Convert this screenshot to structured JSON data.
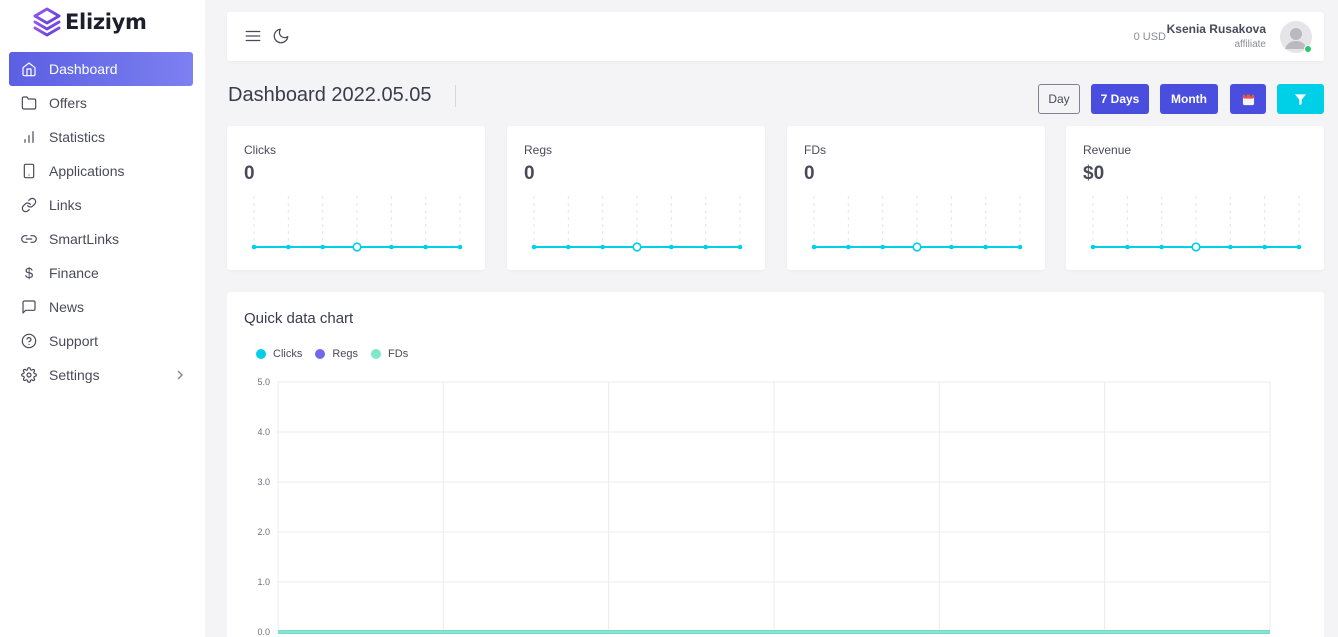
{
  "brand": {
    "name": "Eliziym"
  },
  "sidebar": {
    "items": [
      {
        "label": "Dashboard",
        "icon": "home-icon",
        "active": true
      },
      {
        "label": "Offers",
        "icon": "folder-icon"
      },
      {
        "label": "Statistics",
        "icon": "bar-chart-icon"
      },
      {
        "label": "Applications",
        "icon": "smartphone-icon"
      },
      {
        "label": "Links",
        "icon": "link-icon"
      },
      {
        "label": "SmartLinks",
        "icon": "link-2-icon"
      },
      {
        "label": "Finance",
        "icon": "dollar-sign-icon",
        "glyph": "$"
      },
      {
        "label": "News",
        "icon": "message-square-icon"
      },
      {
        "label": "Support",
        "icon": "help-circle-icon"
      },
      {
        "label": "Settings",
        "icon": "settings-icon"
      }
    ]
  },
  "topbar": {
    "balance": "0 USD",
    "user_name": "Ksenia Rusakova",
    "user_role": "affiliate"
  },
  "page": {
    "title": "Dashboard 2022.05.05",
    "filters": {
      "day": "Day",
      "seven_days": "7 Days",
      "month": "Month"
    }
  },
  "cards": [
    {
      "label": "Clicks",
      "value": "0",
      "spark": [
        0,
        0,
        0,
        0,
        0,
        0,
        0
      ],
      "highlight": 3
    },
    {
      "label": "Regs",
      "value": "0",
      "spark": [
        0,
        0,
        0,
        0,
        0,
        0,
        0
      ],
      "highlight": 3
    },
    {
      "label": "FDs",
      "value": "0",
      "spark": [
        0,
        0,
        0,
        0,
        0,
        0,
        0
      ],
      "highlight": 3
    },
    {
      "label": "Revenue",
      "value": "$0",
      "spark": [
        0,
        0,
        0,
        0,
        0,
        0,
        0
      ],
      "highlight": 3
    }
  ],
  "colors": {
    "accent": "#4a4ede",
    "cyan": "#00cfe8",
    "clicks": "#00cfe8",
    "regs": "#7367f0",
    "fds": "#7ee8c8",
    "online": "#28c76f"
  },
  "chart_data": {
    "type": "line",
    "title": "Quick data chart",
    "legend_position": "top-left",
    "series": [
      {
        "name": "Clicks",
        "values": [
          0,
          0,
          0,
          0,
          0,
          0,
          0
        ]
      },
      {
        "name": "Regs",
        "values": [
          0,
          0,
          0,
          0,
          0,
          0,
          0
        ]
      },
      {
        "name": "FDs",
        "values": [
          0,
          0,
          0,
          0,
          0,
          0,
          0
        ]
      }
    ],
    "y_ticks": [
      "0.0",
      "1.0",
      "2.0",
      "3.0",
      "4.0",
      "5.0"
    ],
    "ylim": [
      0,
      5
    ],
    "grid": true
  }
}
